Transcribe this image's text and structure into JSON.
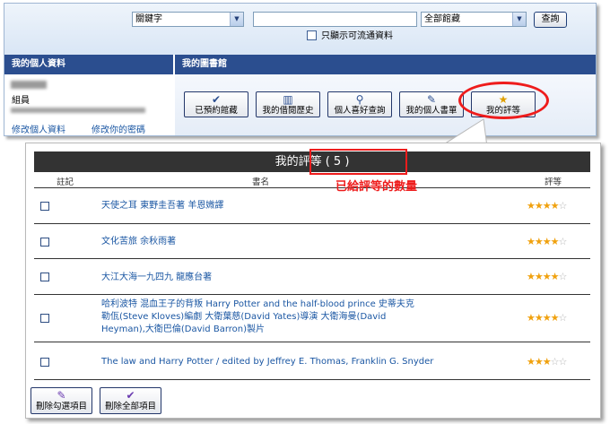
{
  "search": {
    "field_select": "關鍵字",
    "query_value": "",
    "library_select": "全部館藏",
    "search_button": "查詢",
    "available_only_label": "只顯示可流通資料"
  },
  "profile": {
    "header": "我的個人資料",
    "role": "組員",
    "edit_profile_link": "修改個人資料",
    "change_password_link": "修改你的密碼"
  },
  "library": {
    "header": "我的圖書館",
    "buttons": [
      {
        "label": "已預約館藏",
        "icon": "check-icon"
      },
      {
        "label": "我的借閱歷史",
        "icon": "books-icon"
      },
      {
        "label": "個人喜好查詢",
        "icon": "search-binoculars-icon"
      },
      {
        "label": "我的個人書單",
        "icon": "notepad-icon"
      },
      {
        "label": "我的評等",
        "icon": "star-icon"
      }
    ]
  },
  "ratings": {
    "title": "我的評等 ( 5 )",
    "count_annotation": "已給評等的數量",
    "columns": {
      "mark": "註記",
      "title": "書名",
      "rating": "評等"
    },
    "max_stars": 5,
    "rows": [
      {
        "title": "天使之耳 東野圭吾著 羊恩媺譯",
        "rating": 4
      },
      {
        "title": "文化苦旅 余秋雨著",
        "rating": 4
      },
      {
        "title": "大江大海一九四九 龍應台著",
        "rating": 4
      },
      {
        "title": "哈利波特 混血王子的背叛 Harry Potter and the half-blood prince 史蒂夫克勒佤(Steve Kloves)編劇 大衛葉慈(David Yates)導演 大衛海曼(David Heyman),大衛巴倫(David Barron)製片",
        "rating": 4
      },
      {
        "title": "The law and Harry Potter / edited by Jeffrey E. Thomas, Franklin G. Snyder",
        "rating": 3
      }
    ],
    "delete_checked_button": "刪除勾選項目",
    "delete_all_button": "刪除全部項目"
  },
  "colors": {
    "header_blue": "#2b4e8f",
    "link_blue": "#1b57a3",
    "annotation_red": "#ee1c1c",
    "star_gold": "#f0a10e"
  }
}
